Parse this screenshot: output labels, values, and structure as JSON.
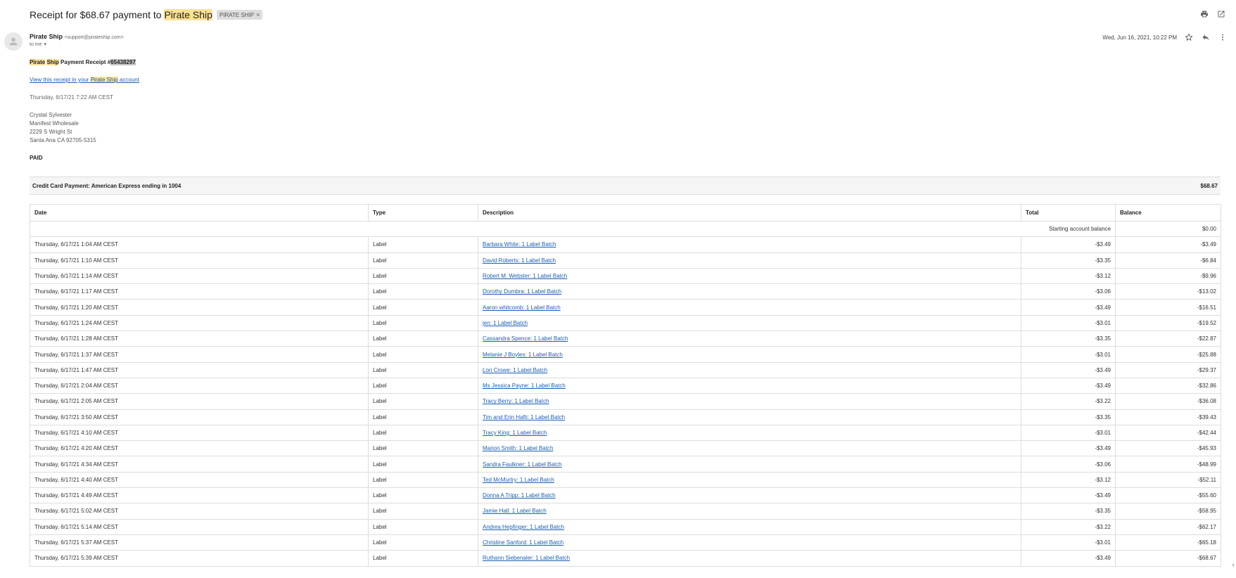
{
  "email": {
    "subject_prefix": "Receipt for $68.67 payment to ",
    "subject_highlight": "Pirate Ship",
    "label_chip": "PIRATE SHIP",
    "sender_name": "Pirate Ship",
    "sender_email": "<support@pirateship.com>",
    "to": "to me",
    "date": "Wed, Jun 16, 2021, 10:22 PM"
  },
  "receipt": {
    "title_hl1": "Pirate",
    "title_hl2": "Ship",
    "title_mid": " Payment Receipt #",
    "receipt_number": "65438297",
    "link_prefix": "View this receipt in your ",
    "link_hl": "Pirate Ship",
    "link_suffix": " account",
    "timestamp": "Thursday, 6/17/21 7:22 AM CEST",
    "address": [
      "Crystal Sylvester",
      "Manifest Wholesale",
      "2229 S Wright St",
      "Santa Ana CA 92705-5315"
    ],
    "status": "PAID",
    "payment_label": "Credit Card Payment: American Express ending in 1004",
    "payment_amount": "$68.67"
  },
  "table": {
    "headers": [
      "Date",
      "Type",
      "Description",
      "Total",
      "Balance"
    ],
    "starting_label": "Starting account balance",
    "starting_balance": "$0.00",
    "rows": [
      [
        "Thursday, 6/17/21 1:04 AM CEST",
        "Label",
        "Barbara White: 1 Label Batch",
        "-$3.49",
        "-$3.49"
      ],
      [
        "Thursday, 6/17/21 1:10 AM CEST",
        "Label",
        "David Roberts: 1 Label Batch",
        "-$3.35",
        "-$6.84"
      ],
      [
        "Thursday, 6/17/21 1:14 AM CEST",
        "Label",
        "Robert M. Webster: 1 Label Batch",
        "-$3.12",
        "-$9.96"
      ],
      [
        "Thursday, 6/17/21 1:17 AM CEST",
        "Label",
        "Dorothy Dumbra: 1 Label Batch",
        "-$3.06",
        "-$13.02"
      ],
      [
        "Thursday, 6/17/21 1:20 AM CEST",
        "Label",
        "Aaron whitcomb: 1 Label Batch",
        "-$3.49",
        "-$16.51"
      ],
      [
        "Thursday, 6/17/21 1:24 AM CEST",
        "Label",
        "jen: 1 Label Batch",
        "-$3.01",
        "-$19.52"
      ],
      [
        "Thursday, 6/17/21 1:28 AM CEST",
        "Label",
        "Cassandra Spence: 1 Label Batch",
        "-$3.35",
        "-$22.87"
      ],
      [
        "Thursday, 6/17/21 1:37 AM CEST",
        "Label",
        "Melanie J Boyles: 1 Label Batch",
        "-$3.01",
        "-$25.88"
      ],
      [
        "Thursday, 6/17/21 1:47 AM CEST",
        "Label",
        "Lori Crowe: 1 Label Batch",
        "-$3.49",
        "-$29.37"
      ],
      [
        "Thursday, 6/17/21 2:04 AM CEST",
        "Label",
        "Ms Jessica Payne: 1 Label Batch",
        "-$3.49",
        "-$32.86"
      ],
      [
        "Thursday, 6/17/21 2:05 AM CEST",
        "Label",
        "Tracy Berry: 1 Label Batch",
        "-$3.22",
        "-$36.08"
      ],
      [
        "Thursday, 6/17/21 3:50 AM CEST",
        "Label",
        "Tim and Erin Hafti: 1 Label Batch",
        "-$3.35",
        "-$39.43"
      ],
      [
        "Thursday, 6/17/21 4:10 AM CEST",
        "Label",
        "Tracy King: 1 Label Batch",
        "-$3.01",
        "-$42.44"
      ],
      [
        "Thursday, 6/17/21 4:20 AM CEST",
        "Label",
        "Marion Smith: 1 Label Batch",
        "-$3.49",
        "-$45.93"
      ],
      [
        "Thursday, 6/17/21 4:34 AM CEST",
        "Label",
        "Sandra Faulkner: 1 Label Batch",
        "-$3.06",
        "-$48.99"
      ],
      [
        "Thursday, 6/17/21 4:40 AM CEST",
        "Label",
        "Ted McMurtry: 1 Label Batch",
        "-$3.12",
        "-$52.11"
      ],
      [
        "Thursday, 6/17/21 4:49 AM CEST",
        "Label",
        "Donna A Tripp: 1 Label Batch",
        "-$3.49",
        "-$55.60"
      ],
      [
        "Thursday, 6/17/21 5:02 AM CEST",
        "Label",
        "Jamie Hall: 1 Label Batch",
        "-$3.35",
        "-$58.95"
      ],
      [
        "Thursday, 6/17/21 5:14 AM CEST",
        "Label",
        "Andrea Hepfinger: 1 Label Batch",
        "-$3.22",
        "-$62.17"
      ],
      [
        "Thursday, 6/17/21 5:37 AM CEST",
        "Label",
        "Christine Sanford: 1 Label Batch",
        "-$3.01",
        "-$65.18"
      ],
      [
        "Thursday, 6/17/21 5:39 AM CEST",
        "Label",
        "Ruthann Siebenaler: 1 Label Batch",
        "-$3.49",
        "-$68.67"
      ]
    ]
  },
  "icons": {
    "print": "print-icon",
    "open_new": "open-in-new-window-icon",
    "star": "star-icon",
    "reply": "reply-icon",
    "more": "more-vertical-icon"
  }
}
